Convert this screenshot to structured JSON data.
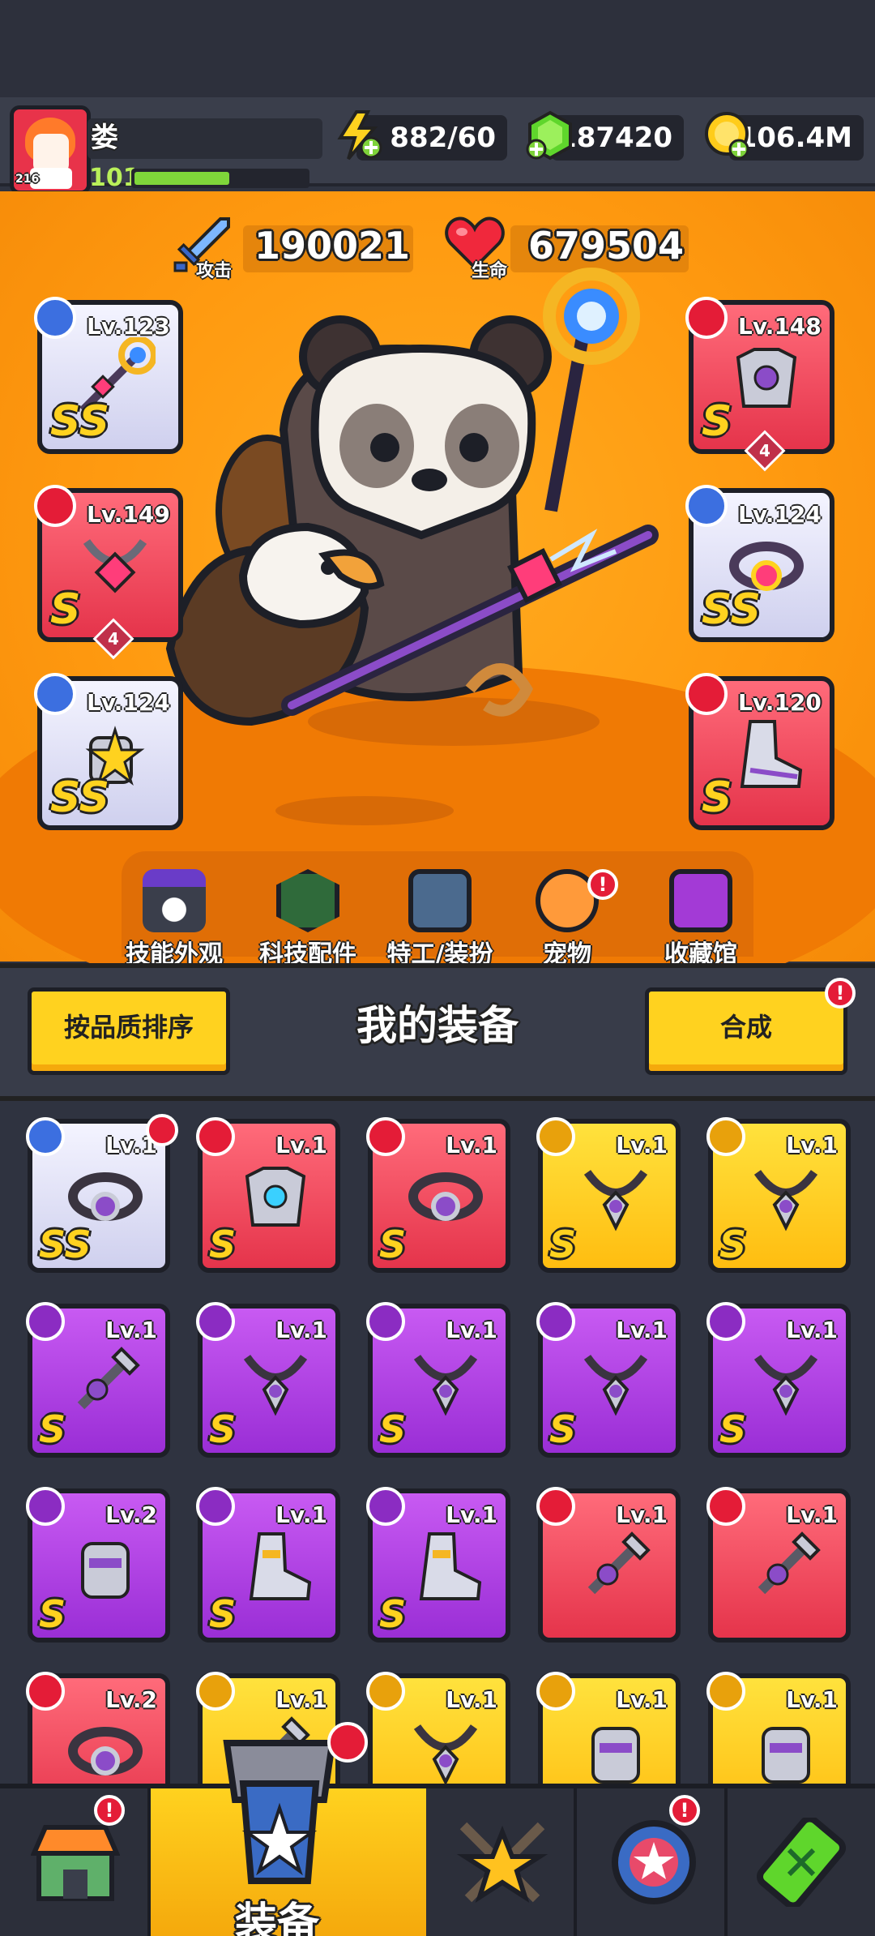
{
  "player": {
    "name": "娄",
    "level": "101",
    "frame_tag": "216",
    "xp_progress": 0.55
  },
  "resources": [
    {
      "name": "energy-icon",
      "value": "882/60",
      "color": "#ffd21f"
    },
    {
      "name": "gem-icon",
      "value": "187420",
      "color": "#5fd62c"
    },
    {
      "name": "coin-icon",
      "value": "106.4M",
      "color": "#ffcc1a"
    }
  ],
  "stats": {
    "attack": {
      "label": "攻击",
      "value": "190021"
    },
    "hp": {
      "label": "生命",
      "value": "679504"
    }
  },
  "equipped": [
    {
      "slot": "weapon",
      "level": "Lv.123",
      "grade": "SS",
      "quality": "white",
      "stars": ""
    },
    {
      "slot": "necklace",
      "level": "Lv.149",
      "grade": "S",
      "quality": "red",
      "stars": "4"
    },
    {
      "slot": "gloves",
      "level": "Lv.124",
      "grade": "SS",
      "quality": "white",
      "stars": ""
    },
    {
      "slot": "armor",
      "level": "Lv.148",
      "grade": "S",
      "quality": "red",
      "stars": "4"
    },
    {
      "slot": "belt",
      "level": "Lv.124",
      "grade": "SS",
      "quality": "white",
      "stars": ""
    },
    {
      "slot": "boots",
      "level": "Lv.120",
      "grade": "S",
      "quality": "red",
      "stars": ""
    }
  ],
  "menu": [
    {
      "label": "技能外观",
      "icon": "skill-skin-icon",
      "badge": ""
    },
    {
      "label": "科技配件",
      "icon": "tech-parts-icon",
      "badge": ""
    },
    {
      "label": "特工/装扮",
      "icon": "agent-outfit-icon",
      "badge": ""
    },
    {
      "label": "宠物",
      "icon": "pet-icon",
      "badge": "!"
    },
    {
      "label": "收藏馆",
      "icon": "collection-icon",
      "badge": ""
    }
  ],
  "equipment_panel": {
    "title": "我的装备",
    "sort_button": "按品质排序",
    "merge_button": "合成",
    "merge_badge": "!"
  },
  "inventory": [
    {
      "level": "Lv.1",
      "grade": "SS",
      "quality": "white",
      "type": "belt",
      "badge": "armor-icon"
    },
    {
      "level": "Lv.1",
      "grade": "S",
      "quality": "red",
      "type": "armor"
    },
    {
      "level": "Lv.1",
      "grade": "S",
      "quality": "red",
      "type": "belt"
    },
    {
      "level": "Lv.1",
      "grade": "S",
      "quality": "yellow",
      "type": "necklace"
    },
    {
      "level": "Lv.1",
      "grade": "S",
      "quality": "yellow",
      "type": "necklace"
    },
    {
      "level": "Lv.1",
      "grade": "S",
      "quality": "purple",
      "type": "weapon"
    },
    {
      "level": "Lv.1",
      "grade": "S",
      "quality": "purple",
      "type": "necklace"
    },
    {
      "level": "Lv.1",
      "grade": "S",
      "quality": "purple",
      "type": "necklace"
    },
    {
      "level": "Lv.1",
      "grade": "S",
      "quality": "purple",
      "type": "necklace"
    },
    {
      "level": "Lv.1",
      "grade": "S",
      "quality": "purple",
      "type": "necklace"
    },
    {
      "level": "Lv.2",
      "grade": "S",
      "quality": "purple",
      "type": "gloves"
    },
    {
      "level": "Lv.1",
      "grade": "S",
      "quality": "purple",
      "type": "boots"
    },
    {
      "level": "Lv.1",
      "grade": "S",
      "quality": "purple",
      "type": "boots"
    },
    {
      "level": "Lv.1",
      "grade": "",
      "quality": "red",
      "type": "weapon"
    },
    {
      "level": "Lv.1",
      "grade": "",
      "quality": "red",
      "type": "weapon"
    },
    {
      "level": "Lv.2",
      "grade": "",
      "quality": "red",
      "type": "belt"
    },
    {
      "level": "Lv.1",
      "grade": "",
      "quality": "yellow",
      "type": "weapon"
    },
    {
      "level": "Lv.1",
      "grade": "",
      "quality": "yellow",
      "type": "necklace"
    },
    {
      "level": "Lv.1",
      "grade": "",
      "quality": "yellow",
      "type": "gloves"
    },
    {
      "level": "Lv.1",
      "grade": "",
      "quality": "yellow",
      "type": "gloves"
    }
  ],
  "nav": [
    {
      "label": "",
      "icon": "shop-icon",
      "badge": "!"
    },
    {
      "label": "装备",
      "icon": "equipment-icon",
      "badge": "armor-icon",
      "active": true
    },
    {
      "label": "",
      "icon": "battle-icon",
      "badge": ""
    },
    {
      "label": "",
      "icon": "talent-orb-icon",
      "badge": "!"
    },
    {
      "label": "",
      "icon": "evolution-icon",
      "badge": ""
    }
  ]
}
